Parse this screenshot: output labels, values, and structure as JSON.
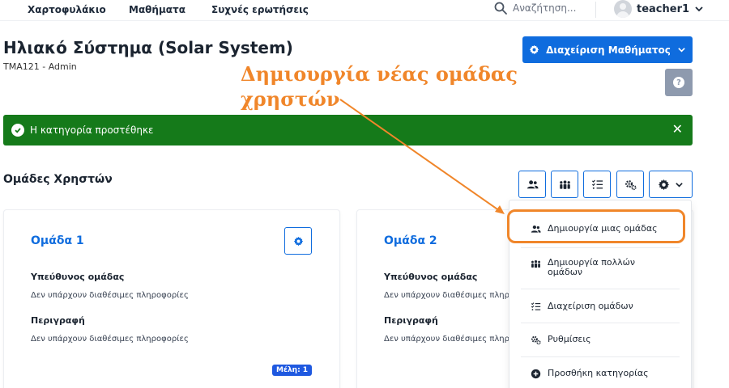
{
  "nav": {
    "items": [
      "Χαρτοφυλάκιο",
      "Μαθήματα",
      "Συχνές ερωτήσεις"
    ],
    "search_placeholder": "Αναζήτηση...",
    "username": "teacher1"
  },
  "course": {
    "title": "Ηλιακό Σύστημα (Solar System)",
    "subtitle": "ΤΜΑ121 - Admin",
    "manage_label": "Διαχείριση Μαθήματος"
  },
  "annotation": {
    "line1": "Δημιουργία νέας ομάδας",
    "line2": "χρηστών",
    "color": "#f0862a"
  },
  "alert": {
    "message": "Η κατηγορία προστέθηκε",
    "color": "#157a1a"
  },
  "section": {
    "title": "Ομάδες Χρηστών"
  },
  "toolbar": {
    "icons": [
      "users-icon",
      "many-users-icon",
      "list-check-icon",
      "cogs-icon",
      "gear-icon"
    ]
  },
  "groups": [
    {
      "name": "Ομάδα 1",
      "leader_label": "Υπεύθυνος ομάδας",
      "leader_value": "Δεν υπάρχουν διαθέσιμες πληροφορίες",
      "desc_label": "Περιγραφή",
      "desc_value": "Δεν υπάρχουν διαθέσιμες πληροφορίες",
      "members": "Μέλη: 1"
    },
    {
      "name": "Ομάδα 2",
      "leader_label": "Υπεύθυνος ομάδας",
      "leader_value": "Δεν υπάρχουν διαθέσιμες πληροφορίες",
      "desc_label": "Περιγραφή",
      "desc_value": "Δεν υπάρχουν διαθέσιμες πληροφορίες"
    }
  ],
  "dropdown": {
    "items": [
      {
        "label": "Δημιουργία μιας ομάδας",
        "icon": "users-icon"
      },
      {
        "label_line1": "Δημιουργία πολλών",
        "label_line2": "ομάδων",
        "icon": "many-users-icon"
      },
      {
        "label": "Διαχείριση ομάδων",
        "icon": "list-check-icon"
      },
      {
        "label": "Ρυθμίσεις",
        "icon": "cogs-icon"
      },
      {
        "label": "Προσθήκη κατηγορίας",
        "icon": "plus-circle-icon"
      }
    ]
  },
  "colors": {
    "primary": "#0f6cde",
    "accent": "#f0862a",
    "success": "#157a1a",
    "badge": "#1f59e0"
  }
}
